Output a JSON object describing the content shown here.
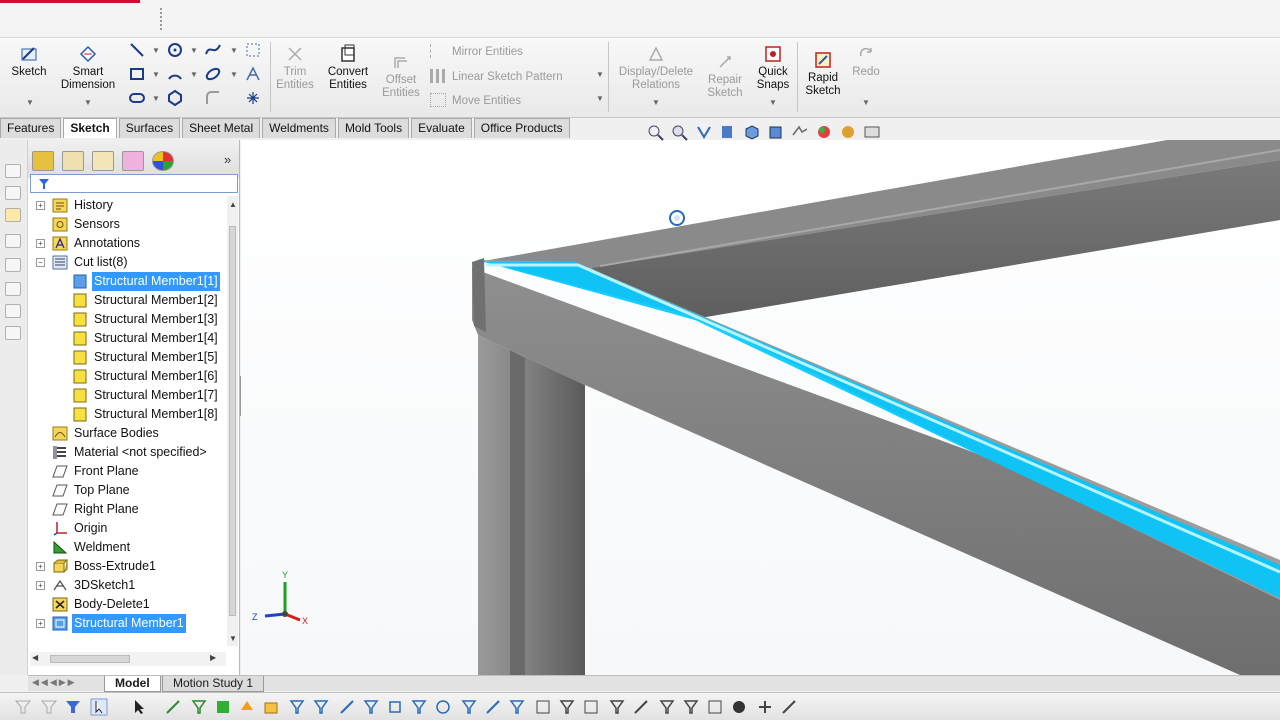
{
  "ribbon": {
    "sketch": "Sketch",
    "smart_dimension": "Smart\nDimension",
    "trim_entities": "Trim\nEntities",
    "convert_entities": "Convert\nEntities",
    "offset_entities": "Offset\nEntities",
    "mirror_entities": "Mirror Entities",
    "linear_sketch_pattern": "Linear Sketch Pattern",
    "move_entities": "Move Entities",
    "display_delete_relations": "Display/Delete\nRelations",
    "repair_sketch": "Repair\nSketch",
    "quick_snaps": "Quick\nSnaps",
    "rapid_sketch": "Rapid\nSketch",
    "redo": "Redo"
  },
  "tabs": [
    "Features",
    "Sketch",
    "Surfaces",
    "Sheet Metal",
    "Weldments",
    "Mold Tools",
    "Evaluate",
    "Office Products"
  ],
  "active_tab": "Sketch",
  "tree": {
    "history": "History",
    "sensors": "Sensors",
    "annotations": "Annotations",
    "cut_list": "Cut list(8)",
    "members": [
      "Structural Member1[1]",
      "Structural Member1[2]",
      "Structural Member1[3]",
      "Structural Member1[4]",
      "Structural Member1[5]",
      "Structural Member1[6]",
      "Structural Member1[7]",
      "Structural Member1[8]"
    ],
    "surface_bodies": "Surface Bodies",
    "material": "Material <not specified>",
    "front_plane": "Front Plane",
    "top_plane": "Top Plane",
    "right_plane": "Right Plane",
    "origin": "Origin",
    "weldment": "Weldment",
    "boss_extrude": "Boss-Extrude1",
    "sketch3d": "3DSketch1",
    "body_delete": "Body-Delete1",
    "structural_member": "Structural Member1"
  },
  "bottom_tabs": {
    "model": "Model",
    "motion_study": "Motion Study 1"
  },
  "triad": {
    "y": "Y",
    "z": "Z",
    "x": "X"
  },
  "colors": {
    "selection_highlight": "#00c8ff",
    "tree_selection": "#3399ff",
    "frame_steel": "#8a8a8a"
  }
}
